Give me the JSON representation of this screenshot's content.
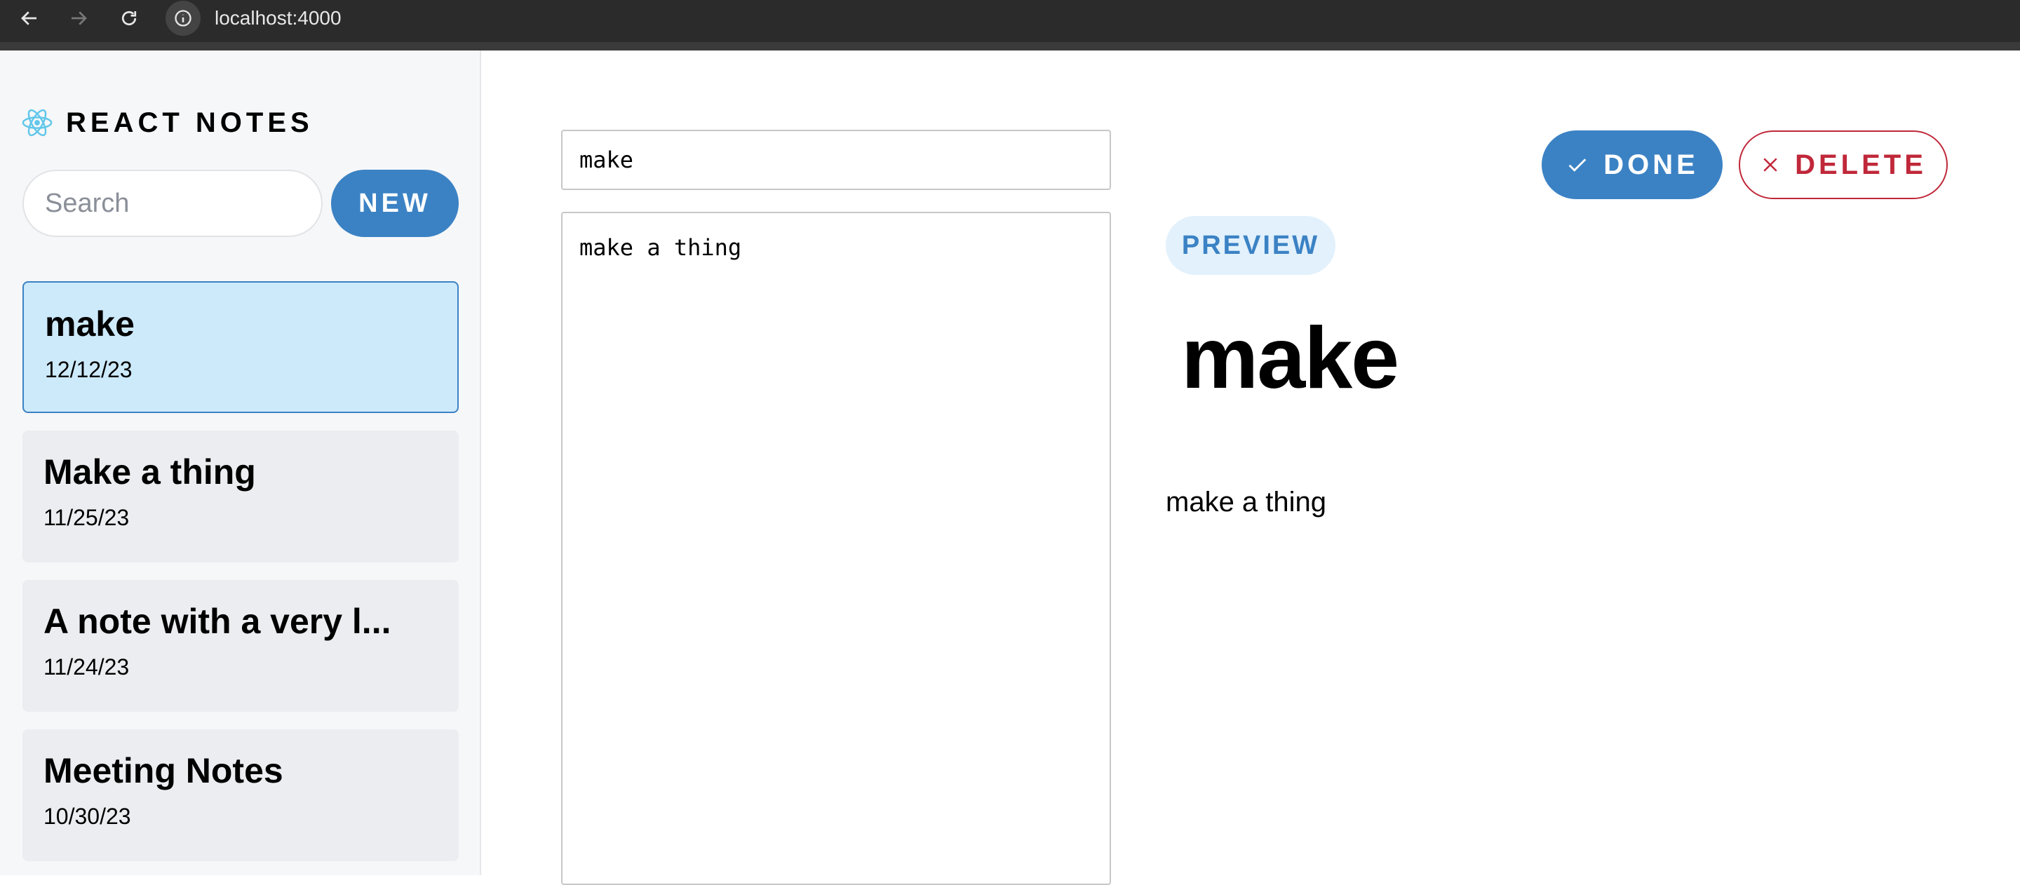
{
  "browser": {
    "url": "localhost:4000"
  },
  "sidebar": {
    "brand_text": "REACT NOTES",
    "search_placeholder": "Search",
    "new_label": "NEW",
    "notes": [
      {
        "title": "make",
        "date": "12/12/23",
        "selected": true
      },
      {
        "title": "Make a thing",
        "date": "11/25/23",
        "selected": false
      },
      {
        "title": "A note with a very l...",
        "date": "11/24/23",
        "selected": false
      },
      {
        "title": "Meeting Notes",
        "date": "10/30/23",
        "selected": false
      }
    ]
  },
  "editor": {
    "title_value": "make",
    "body_value": "make a thing"
  },
  "actions": {
    "done_label": "DONE",
    "delete_label": "DELETE"
  },
  "preview": {
    "badge": "PREVIEW",
    "heading": "make",
    "body": "make a thing"
  },
  "colors": {
    "primary": "#3b82c4",
    "danger": "#c0283a",
    "selected_bg": "#cdeafb",
    "note_bg": "#ebedf0",
    "sidebar_bg": "#f6f7f9",
    "browser_bar": "#2b2b2b"
  }
}
